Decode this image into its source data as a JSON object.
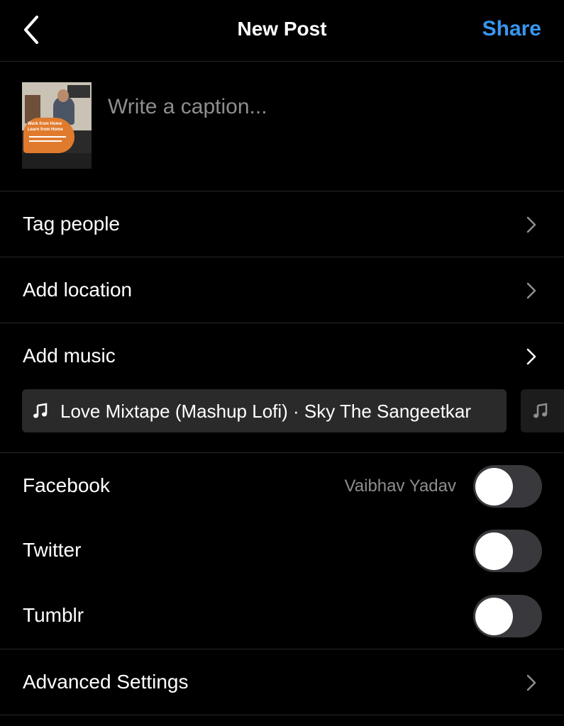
{
  "header": {
    "title": "New Post",
    "share_label": "Share",
    "back_icon": "chevron-left-icon"
  },
  "caption": {
    "placeholder": "Write a caption...",
    "value": ""
  },
  "thumbnail": {
    "text_lines": [
      "Work from Home",
      "Learn from Home"
    ]
  },
  "options": {
    "tag_people": "Tag people",
    "add_location": "Add location",
    "add_music": "Add music",
    "advanced_settings": "Advanced Settings"
  },
  "music": {
    "selected": "Love Mixtape (Mashup Lofi) · Sky The Sangeetkar",
    "icon": "music-note-icon"
  },
  "sharing": {
    "facebook": {
      "label": "Facebook",
      "account": "Vaibhav Yadav",
      "enabled": false
    },
    "twitter": {
      "label": "Twitter",
      "enabled": false
    },
    "tumblr": {
      "label": "Tumblr",
      "enabled": false
    }
  },
  "colors": {
    "accent": "#3897f0",
    "background": "#000000",
    "divider": "#262626",
    "muted_text": "#8e8e8e",
    "toggle_off": "#39393d",
    "chip_bg": "#2a2a2a"
  }
}
